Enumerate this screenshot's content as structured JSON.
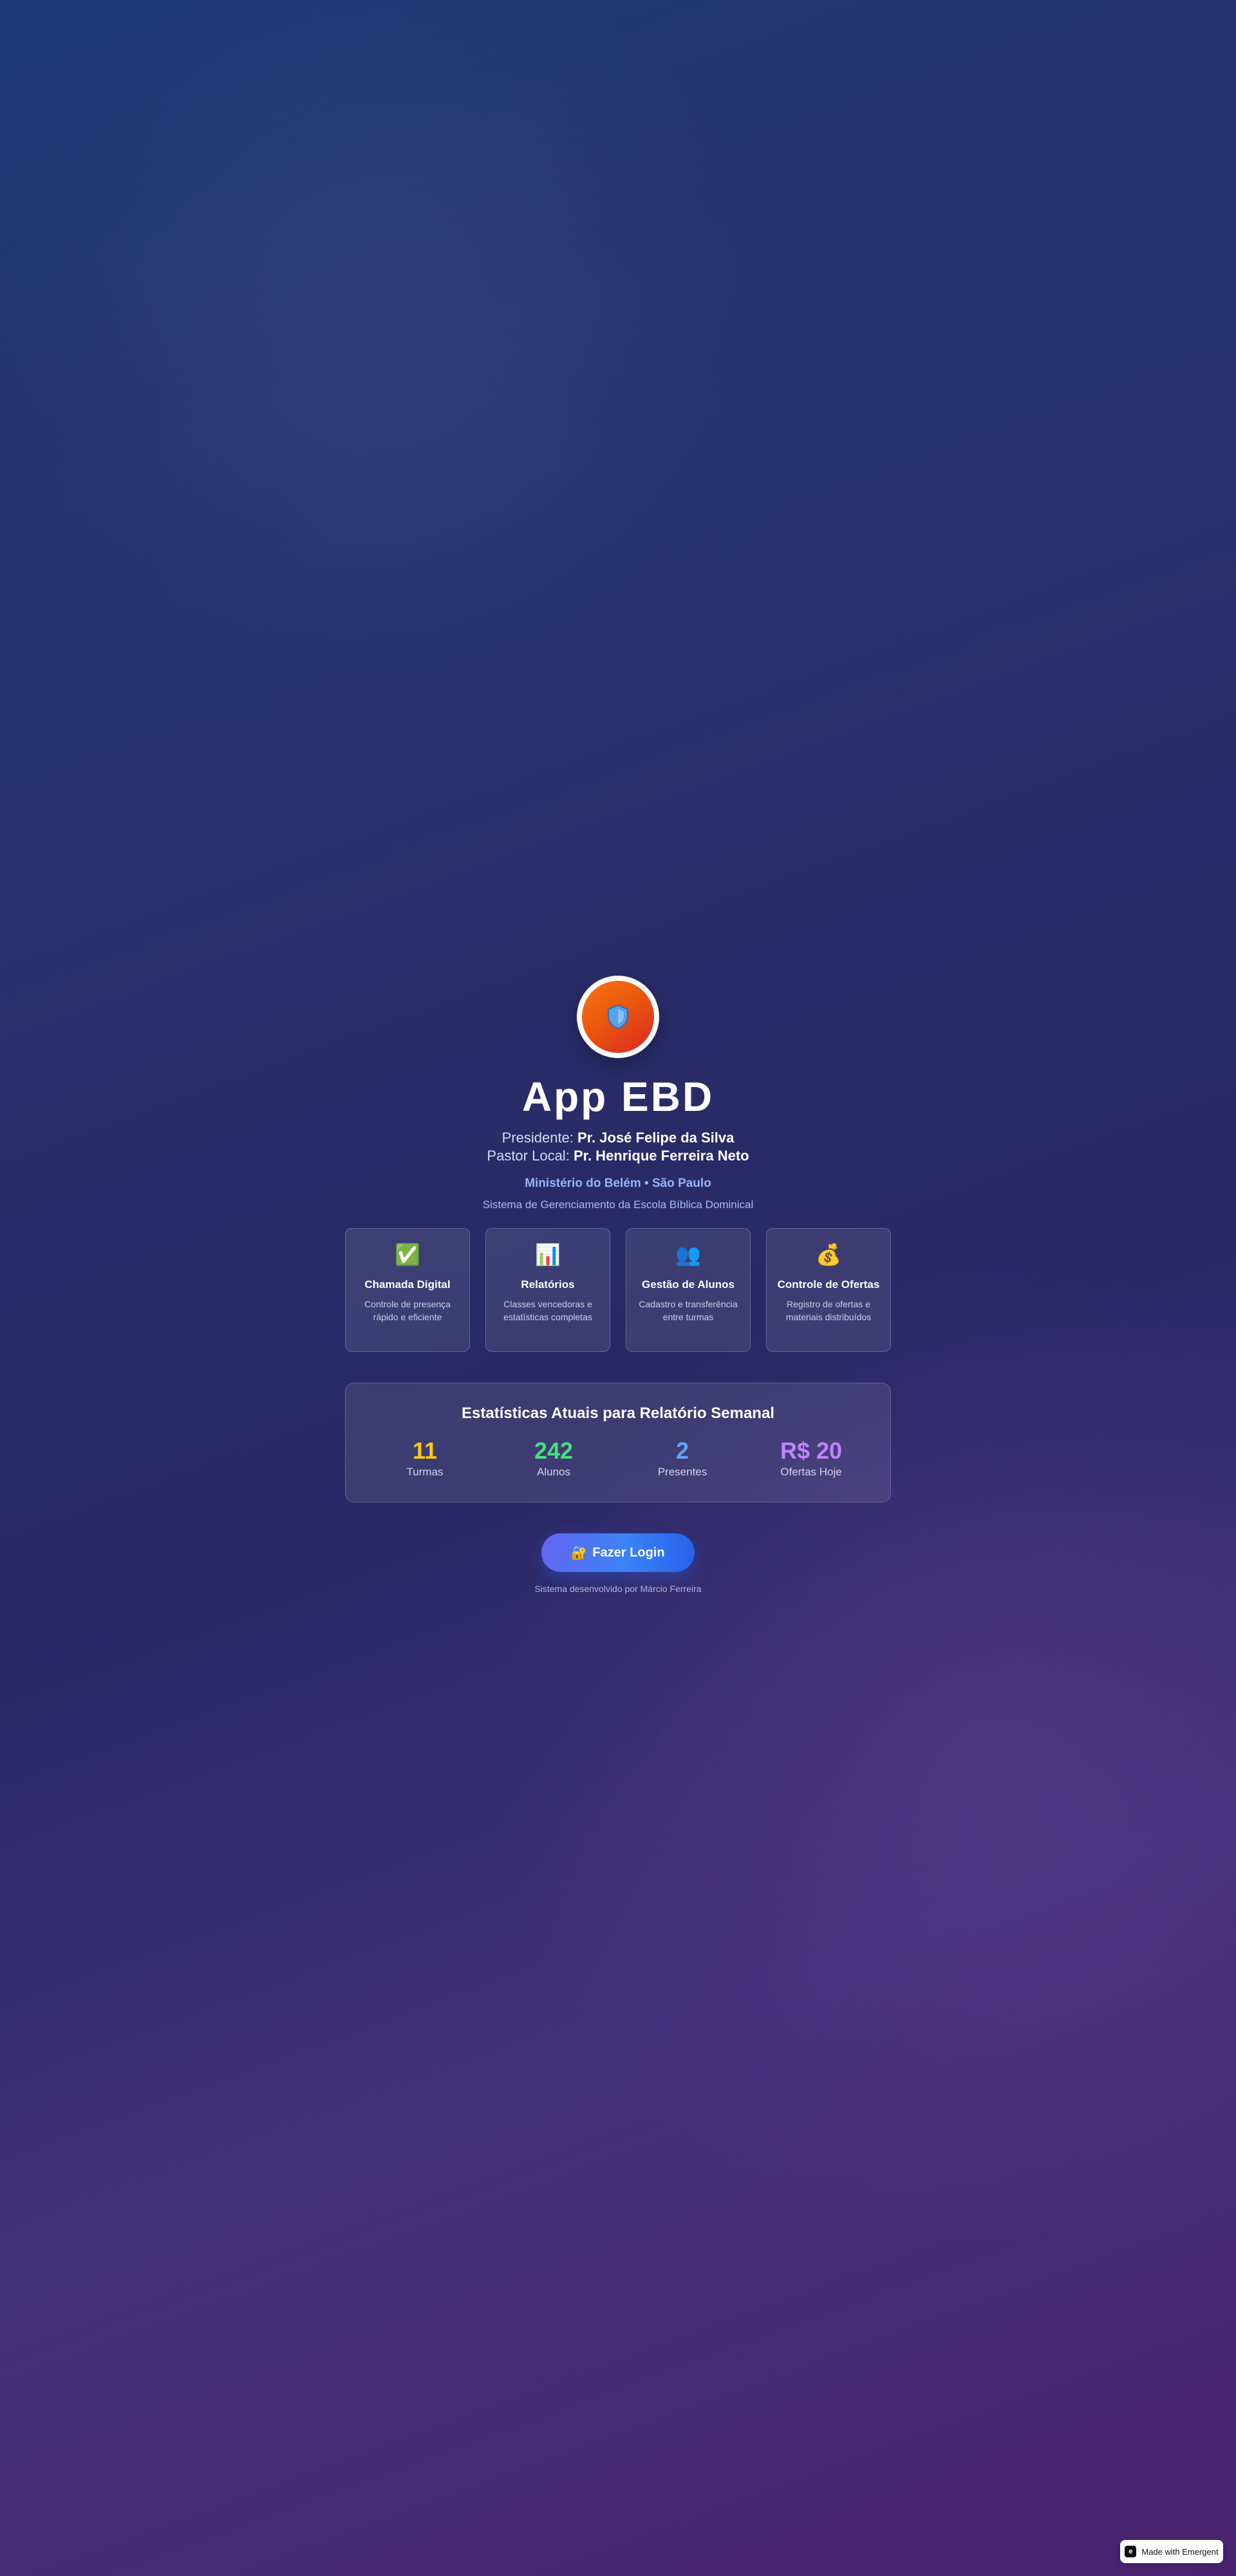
{
  "app": {
    "icon": "shield-icon",
    "title": "App EBD"
  },
  "leadership": {
    "president_label": "Presidente:",
    "president_name": "Pr. José Felipe da Silva",
    "pastor_label": "Pastor Local:",
    "pastor_name": "Pr. Henrique Ferreira Neto"
  },
  "ministry": "Ministério do Belém • São Paulo",
  "system_description": "Sistema de Gerenciamento da Escola Bíblica Dominical",
  "features": [
    {
      "icon": "check-mark-icon",
      "glyph": "✅",
      "title": "Chamada Digital",
      "description": "Controle de presença rápido e eficiente"
    },
    {
      "icon": "bar-chart-icon",
      "glyph": "📊",
      "title": "Relatórios",
      "description": "Classes vencedoras e estatísticas completas"
    },
    {
      "icon": "people-icon",
      "glyph": "👥",
      "title": "Gestão de Alunos",
      "description": "Cadastro e transferência entre turmas"
    },
    {
      "icon": "money-bag-icon",
      "glyph": "💰",
      "title": "Controle de Ofertas",
      "description": "Registro de ofertas e materiais distribuídos"
    }
  ],
  "stats": {
    "title": "Estatísticas Atuais para Relatório Semanal",
    "items": [
      {
        "value": "11",
        "label": "Turmas",
        "color": "#facc15"
      },
      {
        "value": "242",
        "label": "Alunos",
        "color": "#4ade80"
      },
      {
        "value": "2",
        "label": "Presentes",
        "color": "#60a5fa"
      },
      {
        "value": "R$ 20",
        "label": "Ofertas Hoje",
        "color": "#c084fc"
      }
    ]
  },
  "login_button": {
    "icon": "lock-key-icon",
    "glyph": "🔐",
    "label": "Fazer Login"
  },
  "credits": "Sistema desenvolvido por Márcio Ferreira",
  "badge": {
    "icon": "emergent-logo-icon",
    "glyph": "e",
    "label": "Made with Emergent"
  },
  "colors": {
    "logo_gradient_start": "#f97316",
    "logo_gradient_end": "#dc2626",
    "button_gradient_start": "#6366f1",
    "button_gradient_end": "#2563eb",
    "ministry_text": "#93b4ff"
  }
}
